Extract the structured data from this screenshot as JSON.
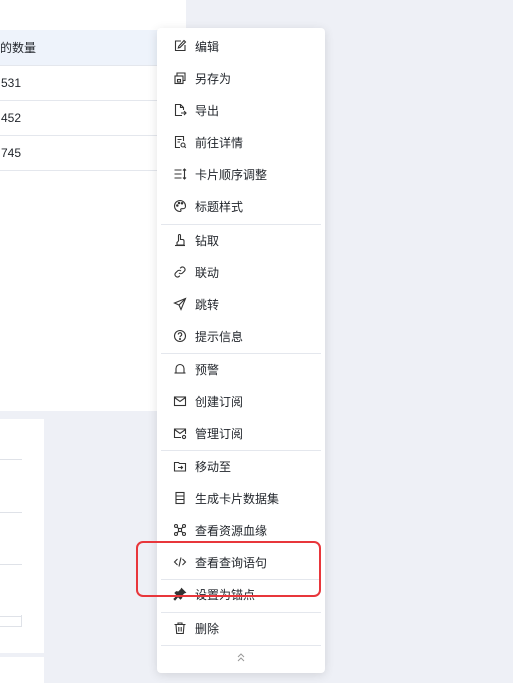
{
  "table": {
    "header": "的数量",
    "rows": [
      "531",
      "452",
      "745"
    ]
  },
  "menu": {
    "items": [
      {
        "label": "编辑",
        "icon": "edit-icon"
      },
      {
        "label": "另存为",
        "icon": "save-as-icon"
      },
      {
        "label": "导出",
        "icon": "export-icon"
      },
      {
        "label": "前往详情",
        "icon": "details-icon"
      },
      {
        "label": "卡片顺序调整",
        "icon": "reorder-icon"
      },
      {
        "label": "标题样式",
        "icon": "palette-icon"
      },
      {
        "label": "钻取",
        "icon": "drill-icon"
      },
      {
        "label": "联动",
        "icon": "link-icon"
      },
      {
        "label": "跳转",
        "icon": "send-icon"
      },
      {
        "label": "提示信息",
        "icon": "help-icon"
      },
      {
        "label": "预警",
        "icon": "bell-icon"
      },
      {
        "label": "创建订阅",
        "icon": "mail-icon"
      },
      {
        "label": "管理订阅",
        "icon": "mail-settings-icon"
      },
      {
        "label": "移动至",
        "icon": "move-icon"
      },
      {
        "label": "生成卡片数据集",
        "icon": "dataset-icon"
      },
      {
        "label": "查看资源血缘",
        "icon": "lineage-icon"
      },
      {
        "label": "查看查询语句",
        "icon": "code-icon"
      },
      {
        "label": "设置为锚点",
        "icon": "pin-icon"
      },
      {
        "label": "删除",
        "icon": "trash-icon"
      }
    ],
    "collapse_icon": "chevron-double-up-icon"
  },
  "highlight": {
    "color": "#e8363b",
    "target": "查看查询语句"
  }
}
